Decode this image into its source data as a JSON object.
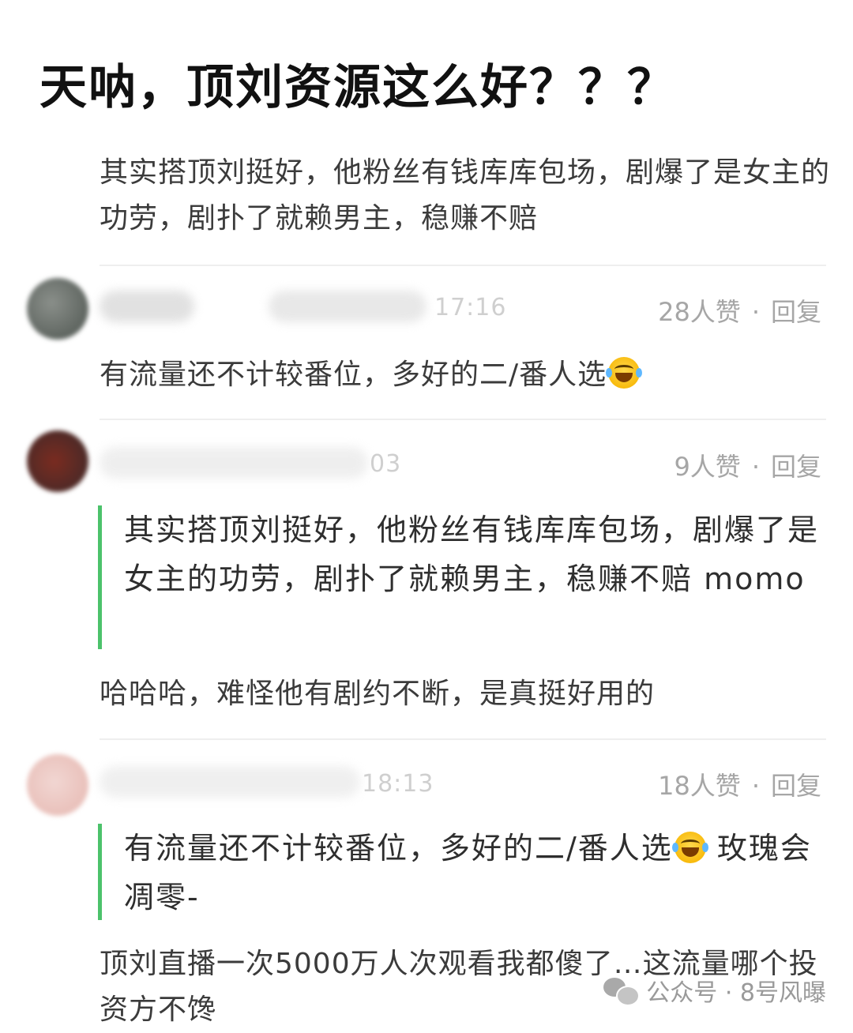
{
  "post": {
    "title": "天呐，顶刘资源这么好？？？"
  },
  "first_comment": {
    "text": "其实搭顶刘挺好，他粉丝有钱库库包场，剧爆了是女主的功劳，剧扑了就赖男主，稳赚不赔"
  },
  "comments": [
    {
      "time_text": "17:16",
      "likes": "28人赞",
      "reply_label": "回复",
      "text": "有流量还不计较番位，多好的二/番人选",
      "emoji": "laughing-crying-emoji"
    },
    {
      "time_text": "03",
      "likes": "9人赞",
      "reply_label": "回复",
      "quote": "其实搭顶刘挺好，他粉丝有钱库库包场，剧爆了是女主的功劳，剧扑了就赖男主，稳赚不赔 momo",
      "text": "哈哈哈，难怪他有剧约不断，是真挺好用的"
    },
    {
      "time_text": "18:13",
      "likes": "18人赞",
      "reply_label": "回复",
      "quote_before_emoji": "有流量还不计较番位，多好的二/番人选",
      "quote_after_emoji": " 玫瑰会凋零-",
      "text": "顶刘直播一次5000万人次观看我都傻了…这流量哪个投资方不馋"
    }
  ],
  "meta_separator": "·",
  "watermark": {
    "text": "公众号 · 8号风曝",
    "icon": "wechat-icon"
  },
  "colors": {
    "quote_bar": "#4cc26b",
    "meta_text": "#a6a6a6",
    "body_text": "#3b3b3b"
  }
}
